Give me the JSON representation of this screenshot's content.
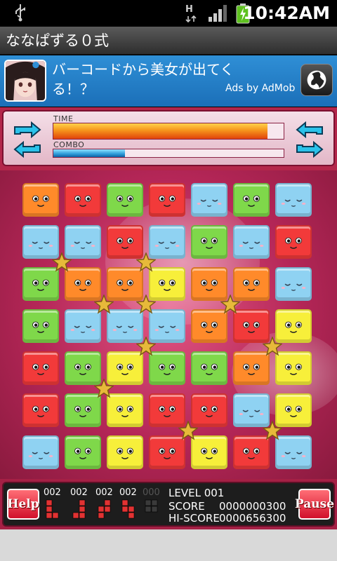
{
  "status_bar": {
    "time": "10:42AM",
    "network": "H"
  },
  "app": {
    "title": "ななぱずる０式"
  },
  "ad": {
    "text": "バーコードから美女が出てくる！？",
    "attribution": "Ads by AdMob"
  },
  "meters": {
    "time_label": "TIME",
    "time_fraction": 0.93,
    "combo_label": "COMBO",
    "combo_fraction": 0.31
  },
  "board": {
    "colors": {
      "orange": "#ff8a2a",
      "red": "#f23a3a",
      "green": "#7fd84a",
      "blue": "#8fd2f2",
      "yellow": "#f7ef3a"
    },
    "rows": [
      [
        "orange",
        "red",
        "green",
        "red",
        "blue",
        "green",
        "blue"
      ],
      [
        "blue",
        "blue",
        "red",
        "blue",
        "green",
        "blue",
        "red"
      ],
      [
        "green",
        "orange",
        "orange",
        "yellow",
        "orange",
        "orange",
        "blue"
      ],
      [
        "green",
        "blue",
        "blue",
        "blue",
        "orange",
        "red",
        "yellow"
      ],
      [
        "red",
        "green",
        "yellow",
        "green",
        "green",
        "orange",
        "yellow"
      ],
      [
        "red",
        "green",
        "yellow",
        "red",
        "red",
        "blue",
        "yellow"
      ],
      [
        "blue",
        "green",
        "yellow",
        "red",
        "yellow",
        "red",
        "blue"
      ]
    ],
    "star_count": 12
  },
  "footer": {
    "help_label": "Help",
    "pause_label": "Pause",
    "counters": [
      {
        "value": "002",
        "dim": false
      },
      {
        "value": "002",
        "dim": false
      },
      {
        "value": "002",
        "dim": false
      },
      {
        "value": "002",
        "dim": false
      },
      {
        "value": "000",
        "dim": true
      }
    ],
    "level_line": "LEVEL 001",
    "score_label": "SCORE",
    "score_value": "0000000300",
    "hiscore_label": "HI-SCORE",
    "hiscore_value": "0000656300"
  }
}
